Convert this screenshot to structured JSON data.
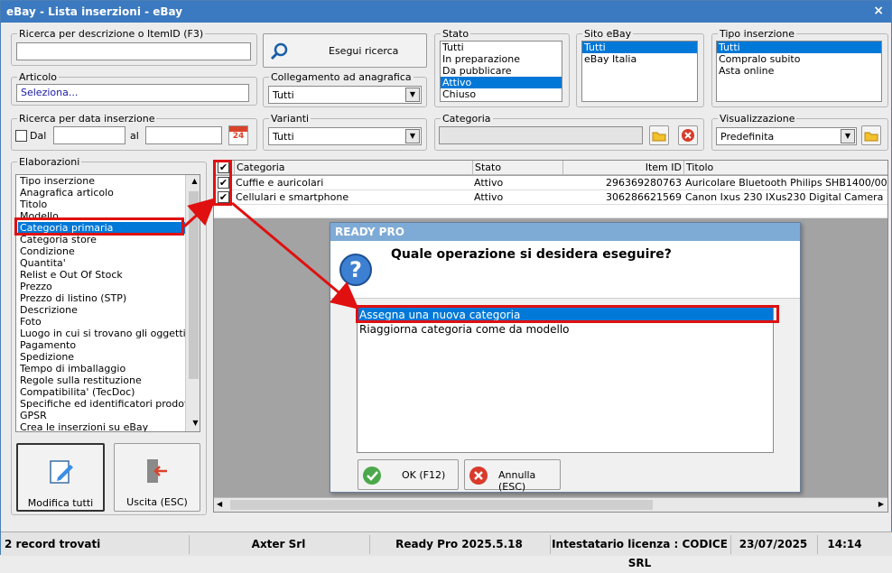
{
  "window": {
    "title": "eBay - Lista inserzioni - eBay",
    "close": "×"
  },
  "search": {
    "label": "Ricerca per descrizione o ItemID (F3)",
    "value": "",
    "button": "Esegui ricerca"
  },
  "articolo": {
    "label": "Articolo",
    "value": "Seleziona..."
  },
  "collegamento": {
    "label": "Collegamento ad anagrafica",
    "value": "Tutti"
  },
  "stato": {
    "label": "Stato",
    "items": [
      "Tutti",
      "In preparazione",
      "Da pubblicare",
      "Attivo",
      "Chiuso"
    ],
    "selected": "Attivo"
  },
  "sito": {
    "label": "Sito eBay",
    "items": [
      "Tutti",
      "eBay Italia"
    ],
    "selected": "Tutti"
  },
  "tipo": {
    "label": "Tipo inserzione",
    "items": [
      "Tutti",
      "Compralo subito",
      "Asta online"
    ],
    "selected": "Tutti"
  },
  "data": {
    "label": "Ricerca per data inserzione",
    "dal": "Dal",
    "al": "al",
    "dal_value": "",
    "al_value": "",
    "cal": "24"
  },
  "varianti": {
    "label": "Varianti",
    "value": "Tutti"
  },
  "categoria": {
    "label": "Categoria",
    "value": ""
  },
  "visualizzazione": {
    "label": "Visualizzazione",
    "value": "Predefinita"
  },
  "elaborazioni": {
    "label": "Elaborazioni",
    "items": [
      "Tipo inserzione",
      "Anagrafica articolo",
      "Titolo",
      "Modello",
      "Categoria primaria",
      "Categoria store",
      "Condizione",
      "Quantita'",
      "Relist e Out Of Stock",
      "Prezzo",
      "Prezzo di listino (STP)",
      "Descrizione",
      "Foto",
      "Luogo in cui si trovano gli oggetti",
      "Pagamento",
      "Spedizione",
      "Tempo di imballaggio",
      "Regole sulla restituzione",
      "Compatibilita' (TecDoc)",
      "Specifiche ed identificatori prodotto",
      "GPSR",
      "Crea le inserzioni su eBay"
    ],
    "selected": "Categoria primaria"
  },
  "buttons": {
    "modifica": "Modifica tutti",
    "uscita": "Uscita (ESC)"
  },
  "table": {
    "headers": [
      "Categoria",
      "Stato",
      "Item ID",
      "Titolo"
    ],
    "rows": [
      {
        "categoria": "Cuffie e auricolari",
        "stato": "Attivo",
        "itemid": "296369280763",
        "titolo": "Auricolare Bluetooth Philips SHB1400/00"
      },
      {
        "categoria": "Cellulari e smartphone",
        "stato": "Attivo",
        "itemid": "306286621569",
        "titolo": "Canon Ixus 230 IXus230 Digital Camera"
      }
    ]
  },
  "dialog": {
    "title": "READY PRO",
    "question": "Quale operazione si desidera eseguire?",
    "options": [
      "Assegna una nuova categoria",
      "Riaggiorna categoria come da modello"
    ],
    "selected": "Assegna una nuova categoria",
    "ok": "OK (F12)",
    "cancel": "Annulla (ESC)"
  },
  "statusbar": {
    "records": "2 record trovati",
    "company": "Axter Srl",
    "version": "Ready Pro 2025.5.18",
    "license": "Intestatario licenza : CODICE SRL",
    "date": "23/07/2025",
    "time": "14:14"
  }
}
